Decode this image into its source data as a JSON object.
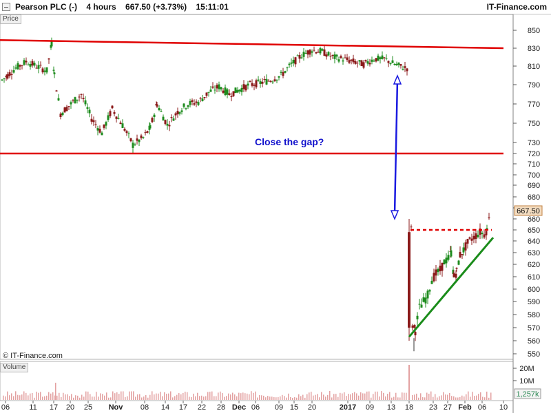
{
  "header": {
    "instrument": "Pearson PLC (-)",
    "timeframe": "4 hours",
    "last_change": "667.50 (+3.73%)",
    "time": "15:11:01",
    "brand": "IT-Finance.com"
  },
  "panels": {
    "price_label": "Price",
    "volume_label": "Volume",
    "copyright": "© IT-Finance.com"
  },
  "colors": {
    "resistance_lines": "#e00000",
    "arrow": "#1a1ae0",
    "annotation_text": "#1010cc",
    "trendline": "#1a8c1a",
    "bull_candle": "#1f8c1f",
    "bear_candle": "#8b1a1a",
    "volume_bars": "#e3a1a1",
    "last_price_box": "#f3dcc0"
  },
  "chart_data": {
    "type": "candlestick",
    "y_ticks": [
      850,
      830,
      810,
      790,
      770,
      750,
      730,
      720,
      710,
      700,
      690,
      680,
      670,
      660,
      650,
      640,
      630,
      620,
      610,
      600,
      590,
      580,
      570,
      560,
      550
    ],
    "x_tick_labels": [
      "06",
      "11",
      "17",
      "20",
      "25",
      "Nov",
      "08",
      "14",
      "17",
      "22",
      "28",
      "Dec",
      "06",
      "09",
      "15",
      "20",
      "2017",
      "09",
      "13",
      "18",
      "23",
      "27",
      "Feb",
      "06",
      "10"
    ],
    "last_price": "667.50",
    "volume_ticks": [
      "20M",
      "10M"
    ],
    "last_volume": "1,257k",
    "annotations": {
      "gap_text": "Close the gap?"
    },
    "series_close_path": [
      [
        0,
        795
      ],
      [
        8,
        800
      ],
      [
        20,
        808
      ],
      [
        35,
        815
      ],
      [
        50,
        810
      ],
      [
        65,
        805
      ],
      [
        72,
        835
      ],
      [
        76,
        800
      ],
      [
        85,
        760
      ],
      [
        100,
        770
      ],
      [
        115,
        780
      ],
      [
        130,
        755
      ],
      [
        145,
        740
      ],
      [
        160,
        765
      ],
      [
        175,
        748
      ],
      [
        190,
        728
      ],
      [
        205,
        735
      ],
      [
        215,
        745
      ],
      [
        225,
        770
      ],
      [
        240,
        748
      ],
      [
        255,
        762
      ],
      [
        270,
        770
      ],
      [
        285,
        772
      ],
      [
        300,
        782
      ],
      [
        315,
        788
      ],
      [
        330,
        780
      ],
      [
        345,
        785
      ],
      [
        360,
        790
      ],
      [
        375,
        792
      ],
      [
        390,
        795
      ],
      [
        405,
        800
      ],
      [
        420,
        812
      ],
      [
        435,
        822
      ],
      [
        450,
        828
      ],
      [
        465,
        826
      ],
      [
        480,
        820
      ],
      [
        495,
        818
      ],
      [
        510,
        815
      ],
      [
        525,
        812
      ],
      [
        540,
        818
      ],
      [
        555,
        818
      ],
      [
        570,
        812
      ],
      [
        585,
        808
      ],
      [
        590,
        808
      ]
    ],
    "series_after_gap": [
      [
        594,
        650
      ],
      [
        596,
        572
      ],
      [
        600,
        568
      ],
      [
        606,
        585
      ],
      [
        612,
        590
      ],
      [
        618,
        595
      ],
      [
        624,
        608
      ],
      [
        630,
        612
      ],
      [
        636,
        615
      ],
      [
        642,
        622
      ],
      [
        648,
        625
      ],
      [
        652,
        630
      ],
      [
        656,
        610
      ],
      [
        660,
        614
      ],
      [
        665,
        628
      ],
      [
        670,
        632
      ],
      [
        676,
        638
      ],
      [
        682,
        642
      ],
      [
        688,
        645
      ],
      [
        694,
        648
      ],
      [
        700,
        646
      ],
      [
        704,
        650
      ],
      [
        708,
        667.5
      ]
    ],
    "resistance_upper": {
      "start": [
        0,
        839
      ],
      "end": [
        731,
        830
      ]
    },
    "support_mid": {
      "start": [
        0,
        720
      ],
      "end": [
        731,
        720
      ]
    },
    "gap_level": {
      "price": 650,
      "start": 596,
      "end": 714
    },
    "trend_support": {
      "start": [
        594,
        563
      ],
      "end": [
        716,
        643
      ]
    }
  }
}
